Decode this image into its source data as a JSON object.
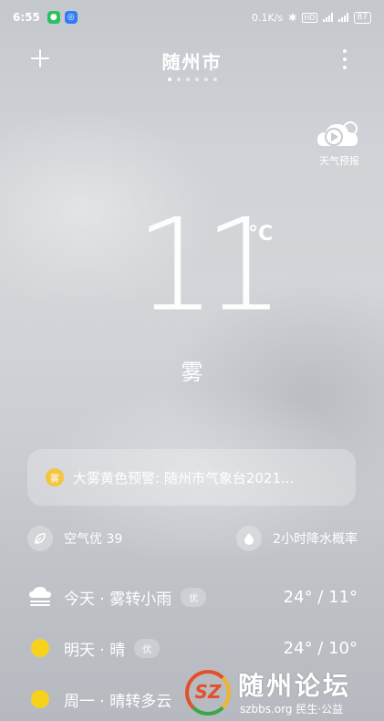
{
  "status_bar": {
    "time": "6:55",
    "network_speed": "0.1K/s",
    "battery": "87"
  },
  "header": {
    "city": "随州市",
    "page_dots": 6,
    "active_dot": 0
  },
  "forecast_button": {
    "label": "天气预报"
  },
  "current": {
    "temperature": "11",
    "unit": "°C",
    "condition": "雾"
  },
  "warning": {
    "icon_text": "雾",
    "text": "大雾黄色预警: 随州市气象台2021..."
  },
  "info": {
    "air_quality": "空气优 39",
    "precipitation": "2小时降水概率"
  },
  "days": [
    {
      "name": "今天 · 雾转小雨",
      "aqi": "优",
      "range": "24° / 11°",
      "icon": "fog-rain-icon"
    },
    {
      "name": "明天 · 晴",
      "aqi": "优",
      "range": "24° / 10°",
      "icon": "sun-icon"
    },
    {
      "name": "周一 · 晴转多云",
      "aqi": "",
      "range": "",
      "icon": "sun-icon"
    }
  ],
  "watermark": {
    "logo_text": "SZ",
    "brand": "随州论坛",
    "site": "szbbs.org 民生·公益"
  },
  "colors": {
    "sun": "#f7d21d",
    "warning": "#f5c542"
  }
}
